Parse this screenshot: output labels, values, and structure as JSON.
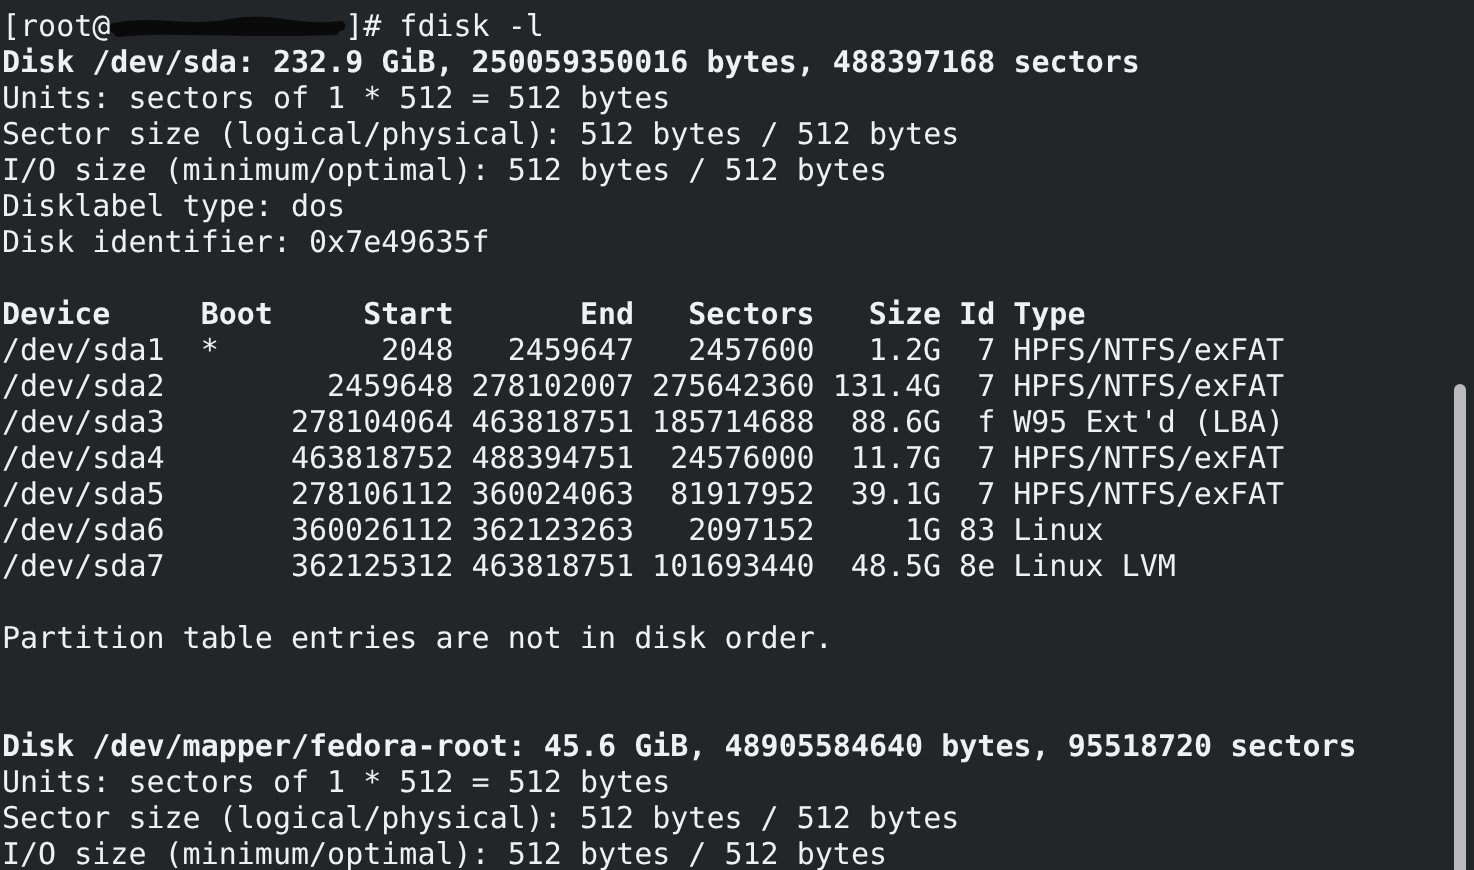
{
  "terminal": {
    "prompt": {
      "user_part": "[root@",
      "command_part": "]# fdisk -l"
    },
    "lines": [
      {
        "kind": "bold",
        "text": "Disk /dev/sda: 232.9 GiB, 250059350016 bytes, 488397168 sectors"
      },
      {
        "kind": "plain",
        "text": "Units: sectors of 1 * 512 = 512 bytes"
      },
      {
        "kind": "plain",
        "text": "Sector size (logical/physical): 512 bytes / 512 bytes"
      },
      {
        "kind": "plain",
        "text": "I/O size (minimum/optimal): 512 bytes / 512 bytes"
      },
      {
        "kind": "plain",
        "text": "Disklabel type: dos"
      },
      {
        "kind": "plain",
        "text": "Disk identifier: 0x7e49635f"
      },
      {
        "kind": "blank"
      },
      {
        "kind": "table",
        "columns": [
          "Device",
          "Boot",
          "Start",
          "End",
          "Sectors",
          "Size",
          "Id",
          "Type"
        ],
        "rows": [
          {
            "cells": [
              "/dev/sda1",
              "*",
              "2048",
              "2459647",
              "2457600",
              "1.2G",
              "7",
              "HPFS/NTFS/exFAT"
            ]
          },
          {
            "cells": [
              "/dev/sda2",
              null,
              "2459648",
              "278102007",
              "275642360",
              "131.4G",
              "7",
              "HPFS/NTFS/exFAT"
            ]
          },
          {
            "cells": [
              "/dev/sda3",
              null,
              "278104064",
              "463818751",
              "185714688",
              "88.6G",
              "f",
              "W95 Ext'd (LBA)"
            ]
          },
          {
            "cells": [
              "/dev/sda4",
              null,
              "463818752",
              "488394751",
              "24576000",
              "11.7G",
              "7",
              "HPFS/NTFS/exFAT"
            ]
          },
          {
            "cells": [
              "/dev/sda5",
              null,
              "278106112",
              "360024063",
              "81917952",
              "39.1G",
              "7",
              "HPFS/NTFS/exFAT"
            ]
          },
          {
            "cells": [
              "/dev/sda6",
              null,
              "360026112",
              "362123263",
              "2097152",
              "1G",
              "83",
              "Linux"
            ]
          },
          {
            "cells": [
              "/dev/sda7",
              null,
              "362125312",
              "463818751",
              "101693440",
              "48.5G",
              "8e",
              "Linux LVM"
            ]
          }
        ]
      },
      {
        "kind": "blank"
      },
      {
        "kind": "plain",
        "text": "Partition table entries are not in disk order."
      },
      {
        "kind": "blank"
      },
      {
        "kind": "blank"
      },
      {
        "kind": "bold",
        "text": "Disk /dev/mapper/fedora-root: 45.6 GiB, 48905584640 bytes, 95518720 sectors"
      },
      {
        "kind": "plain",
        "text": "Units: sectors of 1 * 512 = 512 bytes"
      },
      {
        "kind": "plain",
        "text": "Sector size (logical/physical): 512 bytes / 512 bytes"
      },
      {
        "kind": "plain",
        "text": "I/O size (minimum/optimal): 512 bytes / 512 bytes"
      }
    ]
  }
}
